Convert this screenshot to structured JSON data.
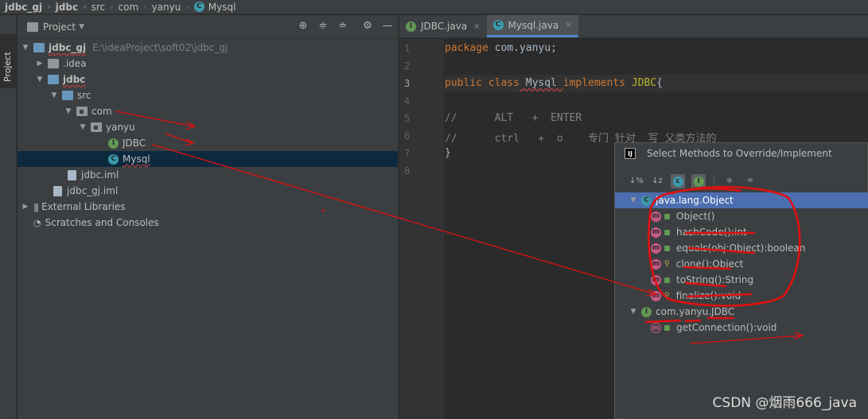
{
  "breadcrumb": [
    "jdbc_gj",
    "jdbc",
    "src",
    "com",
    "yanyu",
    "Mysql"
  ],
  "project_panel": {
    "title": "Project",
    "stripe_label": "Project",
    "tree": [
      {
        "label": "jdbc_gj",
        "path": "E:\\ideaProject\\soft02\\jdbc_gj"
      },
      {
        "label": ".idea"
      },
      {
        "label": "jdbc"
      },
      {
        "label": "src"
      },
      {
        "label": "com"
      },
      {
        "label": "yanyu"
      },
      {
        "label": "JDBC"
      },
      {
        "label": "Mysql"
      },
      {
        "label": "jdbc.iml"
      },
      {
        "label": "jdbc_gj.iml"
      },
      {
        "label": "External Libraries"
      },
      {
        "label": "Scratches and Consoles"
      }
    ]
  },
  "editor": {
    "tabs": [
      {
        "label": "JDBC.java",
        "close": "×"
      },
      {
        "label": "Mysql.java",
        "close": "×"
      }
    ],
    "line_numbers": [
      "1",
      "2",
      "3",
      "4",
      "5",
      "6",
      "7",
      "8"
    ],
    "code": {
      "l1_kw": "package",
      "l1_rest": " com.yanyu;",
      "l3_kw": "public class",
      "l3_cls": " Mysql ",
      "l3_kw2": "implements",
      "l3_iface": " JDBC",
      "l3_brace": "{",
      "l5": "//      ALT   +  ENTER",
      "l6": "//      ctrl   +  o    专门 针对  写 父类方法的",
      "l7": "}"
    }
  },
  "dialog": {
    "title": "Select Methods to Override/Implement",
    "logo": "IJ",
    "groups": [
      {
        "label": "java.lang.Object",
        "methods": [
          "Object()",
          "hashCode():int",
          "equals(obj:Object):boolean",
          "clone():Object",
          "toString():String",
          "finalize():void"
        ]
      },
      {
        "label": "com.yanyu.JDBC",
        "methods": [
          "getConnection():void"
        ]
      }
    ]
  },
  "watermark": "CSDN @烟雨666_java",
  "colors": {
    "annotation": "#e01010",
    "selection": "#4b6eaf"
  }
}
